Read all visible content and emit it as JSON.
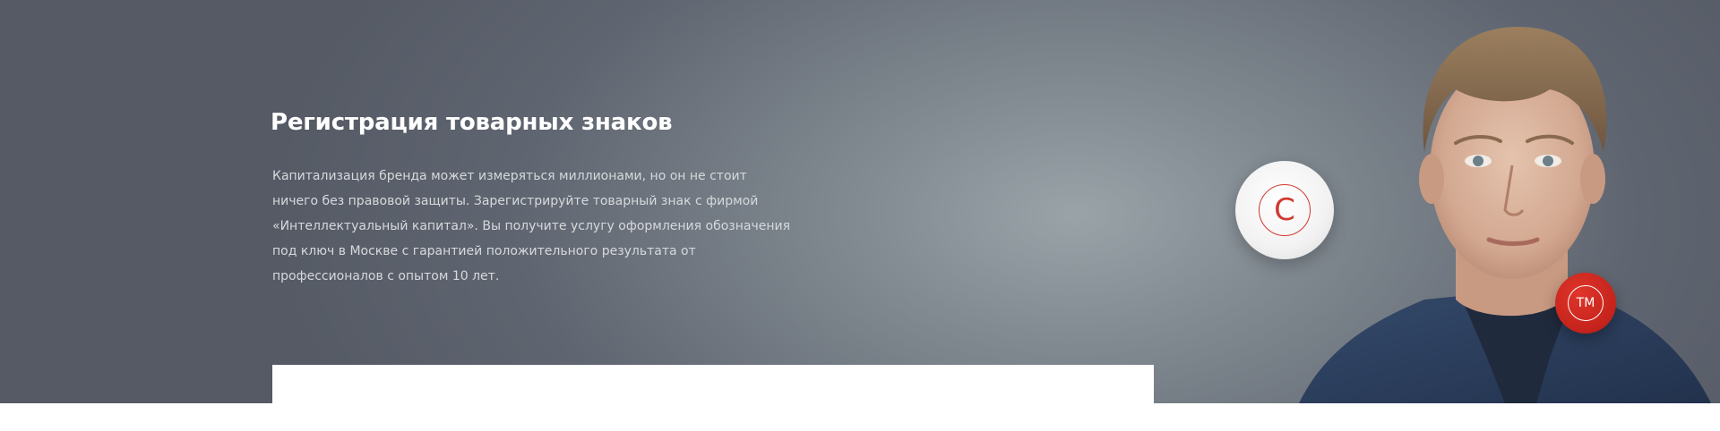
{
  "hero": {
    "title": "Регистрация товарных знаков",
    "description": "Капитализация бренда может измеряться миллионами, но он не стоит ничего без правовой защиты. Зарегистрируйте товарный знак с фирмой «Интеллектуальный капитал». Вы получите услугу оформления обозначения под ключ в Москве с гарантией положительного результата от профессионалов с опытом 10 лет.",
    "copyright_symbol": "C",
    "tm_symbol": "TM"
  },
  "icons": {
    "copyright": "copyright-icon",
    "trademark": "trademark-icon"
  },
  "colors": {
    "accent_red": "#c4231b",
    "title": "#ffffff",
    "text": "#d6d9dc"
  }
}
